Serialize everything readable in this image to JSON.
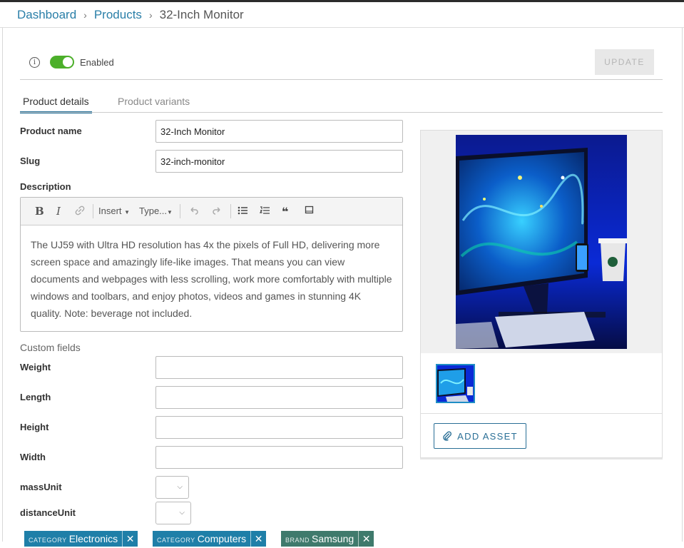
{
  "breadcrumb": {
    "items": [
      "Dashboard",
      "Products",
      "32-Inch Monitor"
    ],
    "separator": "›"
  },
  "status": {
    "enabled": true,
    "enabled_label": "Enabled",
    "info_icon": "ⓘ"
  },
  "toolbar": {
    "update_label": "UPDATE"
  },
  "tabs": [
    {
      "label": "Product details",
      "active": true
    },
    {
      "label": "Product variants",
      "active": false
    }
  ],
  "fields": {
    "name_label": "Product name",
    "name_value": "32-Inch Monitor",
    "slug_label": "Slug",
    "slug_value": "32-inch-monitor",
    "description_label": "Description"
  },
  "editor": {
    "bold": "B",
    "italic": "I",
    "insert": "Insert",
    "type": "Type...",
    "text": "The UJ59 with Ultra HD resolution has 4x the pixels of Full HD, delivering more screen space and amazingly life-like images. That means you can view documents and webpages with less scrolling, work more comfortably with multiple windows and toolbars, and enjoy photos, videos and games in stunning 4K quality. Note: beverage not included."
  },
  "custom_fields": {
    "section_label": "Custom fields",
    "weight": "Weight",
    "length": "Length",
    "height": "Height",
    "width": "Width",
    "mass_unit": "massUnit",
    "distance_unit": "distanceUnit"
  },
  "facets": [
    {
      "type": "CATEGORY",
      "value": "Electronics",
      "color": "#1f7fa8"
    },
    {
      "type": "CATEGORY",
      "value": "Computers",
      "color": "#1f7fa8"
    },
    {
      "type": "BRAND",
      "value": "Samsung",
      "color": "#3f7a6c"
    }
  ],
  "assets": {
    "add_label": "ADD ASSET"
  },
  "colors": {
    "accent": "#2a7fa8",
    "toggle_on": "#4caf2a",
    "tab_active": "#1d6b94"
  }
}
